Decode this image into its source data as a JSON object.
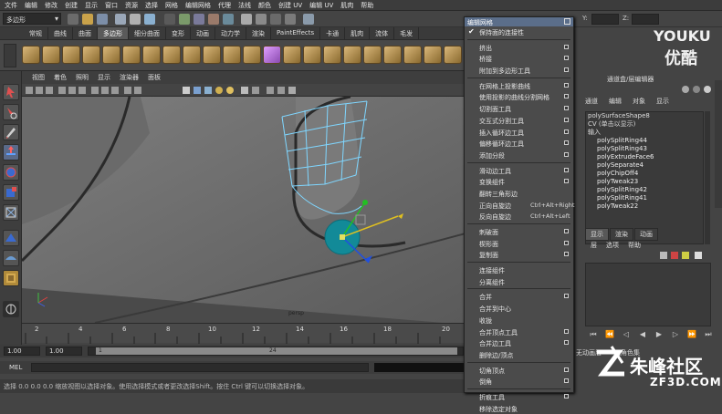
{
  "menubar": [
    "文件",
    "编辑",
    "修改",
    "创建",
    "显示",
    "窗口",
    "资源",
    "选择",
    "网格",
    "编辑网格",
    "代理",
    "法线",
    "颜色",
    "创建 UV",
    "编辑 UV",
    "肌肉",
    "帮助"
  ],
  "statusline": {
    "mode": "多边形",
    "x_label": "X:",
    "y_label": "Y:",
    "z_label": "Z:"
  },
  "shelf_tabs": [
    {
      "label": "常规",
      "active": false
    },
    {
      "label": "曲线",
      "active": false
    },
    {
      "label": "曲面",
      "active": false
    },
    {
      "label": "多边形",
      "active": true
    },
    {
      "label": "细分曲面",
      "active": false
    },
    {
      "label": "变形",
      "active": false
    },
    {
      "label": "动画",
      "active": false
    },
    {
      "label": "动力学",
      "active": false
    },
    {
      "label": "渲染",
      "active": false
    },
    {
      "label": "PaintEffects",
      "active": false
    },
    {
      "label": "卡通",
      "active": false
    },
    {
      "label": "肌肉",
      "active": false
    },
    {
      "label": "流体",
      "active": false
    },
    {
      "label": "毛发",
      "active": false
    }
  ],
  "viewport_menu": [
    "视图",
    "着色",
    "照明",
    "显示",
    "渲染器",
    "面板"
  ],
  "viewport": {
    "camera_label": "persp"
  },
  "timeslider": {
    "ticks": [
      "2",
      "4",
      "6",
      "8",
      "10",
      "12",
      "14",
      "16",
      "18",
      "20"
    ]
  },
  "range": {
    "start": "1.00",
    "current": "1.00",
    "frame_a": "1",
    "frame_b": "24"
  },
  "mel": {
    "label": "MEL"
  },
  "helpline": "选择 0.0 0.0 0.0 缩放视图以选择对象。使用选择模式或者更改选择Shift。按住 Ctrl 键可以切换选择对象。",
  "menu": {
    "title": "编辑网格",
    "items": [
      {
        "label": "保持面的连接性",
        "type": "check"
      },
      {
        "type": "sep"
      },
      {
        "label": "挤出",
        "type": "ob"
      },
      {
        "label": "桥接",
        "type": "ob"
      },
      {
        "label": "附加到多边形工具",
        "type": "ob"
      },
      {
        "type": "sep"
      },
      {
        "label": "在网格上投影曲线",
        "type": "ob"
      },
      {
        "label": "使用投影的曲线分割网格",
        "type": "ob"
      },
      {
        "label": "切割面工具",
        "type": "ob"
      },
      {
        "label": "交互式分割工具",
        "type": "ob"
      },
      {
        "label": "插入循环边工具",
        "type": "ob"
      },
      {
        "label": "偏移循环边工具",
        "type": "ob"
      },
      {
        "label": "添加分段",
        "type": "ob"
      },
      {
        "type": "sep"
      },
      {
        "label": "滑动边工具",
        "type": "ob"
      },
      {
        "label": "变换组件",
        "type": "ob"
      },
      {
        "label": "翻转三角形边",
        "type": "plain"
      },
      {
        "label": "正向自旋边",
        "type": "sc",
        "shortcut": "Ctrl+Alt+Right"
      },
      {
        "label": "反向自旋边",
        "type": "sc",
        "shortcut": "Ctrl+Alt+Left"
      },
      {
        "type": "sep"
      },
      {
        "label": "刺破面",
        "type": "ob"
      },
      {
        "label": "楔形面",
        "type": "ob"
      },
      {
        "label": "复制面",
        "type": "ob"
      },
      {
        "type": "sep"
      },
      {
        "label": "连接组件",
        "type": "plain"
      },
      {
        "label": "分离组件",
        "type": "plain"
      },
      {
        "type": "sep"
      },
      {
        "label": "合并",
        "type": "ob"
      },
      {
        "label": "合并到中心",
        "type": "plain"
      },
      {
        "label": "收拢",
        "type": "plain"
      },
      {
        "label": "合并顶点工具",
        "type": "ob"
      },
      {
        "label": "合并边工具",
        "type": "ob"
      },
      {
        "label": "删除边/顶点",
        "type": "plain"
      },
      {
        "type": "sep"
      },
      {
        "label": "切角顶点",
        "type": "ob"
      },
      {
        "label": "倒角",
        "type": "ob"
      },
      {
        "type": "sep"
      },
      {
        "label": "折痕工具",
        "type": "ob"
      },
      {
        "label": "移除选定对象",
        "type": "plain"
      }
    ]
  },
  "channelbox": {
    "title": "通道盒/层编辑器",
    "menu": [
      "通道",
      "编辑",
      "对象",
      "显示"
    ],
    "items": [
      {
        "label": "polySurfaceShape8",
        "cls": "in"
      },
      {
        "label": "CV (单击以显示)",
        "cls": "in"
      },
      {
        "label": "输入",
        "cls": "in"
      },
      {
        "label": "polySplitRing44",
        "cls": "ind"
      },
      {
        "label": "polySplitRing43",
        "cls": "ind"
      },
      {
        "label": "polyExtrudeFace6",
        "cls": "ind"
      },
      {
        "label": "polySeparate4",
        "cls": "ind"
      },
      {
        "label": "polyChipOff4",
        "cls": "ind"
      },
      {
        "label": "polyTweak23",
        "cls": "ind"
      },
      {
        "label": "polySplitRing42",
        "cls": "ind"
      },
      {
        "label": "polySplitRing41",
        "cls": "ind"
      },
      {
        "label": "polyTweak22",
        "cls": "ind"
      }
    ],
    "layer_tabs": [
      {
        "label": "显示",
        "on": true
      },
      {
        "label": "渲染",
        "on": false
      },
      {
        "label": "动画",
        "on": false
      }
    ],
    "layer_menu": [
      "层",
      "选项",
      "帮助"
    ]
  },
  "right_bottom": {
    "anim_layer": "无动画层",
    "char_set": "无角色集"
  },
  "watermarks": {
    "youku_text": "YOUKU",
    "youku_cn": "优酷",
    "site_cn": "朱峰社区",
    "site_url": "ZF3D.COM"
  },
  "colors": {
    "menu_title": "#5b6e8a",
    "viewport_bg": "#6e6e6e",
    "wire": "#7fd6ff",
    "gizmo": "#1a8c9c"
  }
}
